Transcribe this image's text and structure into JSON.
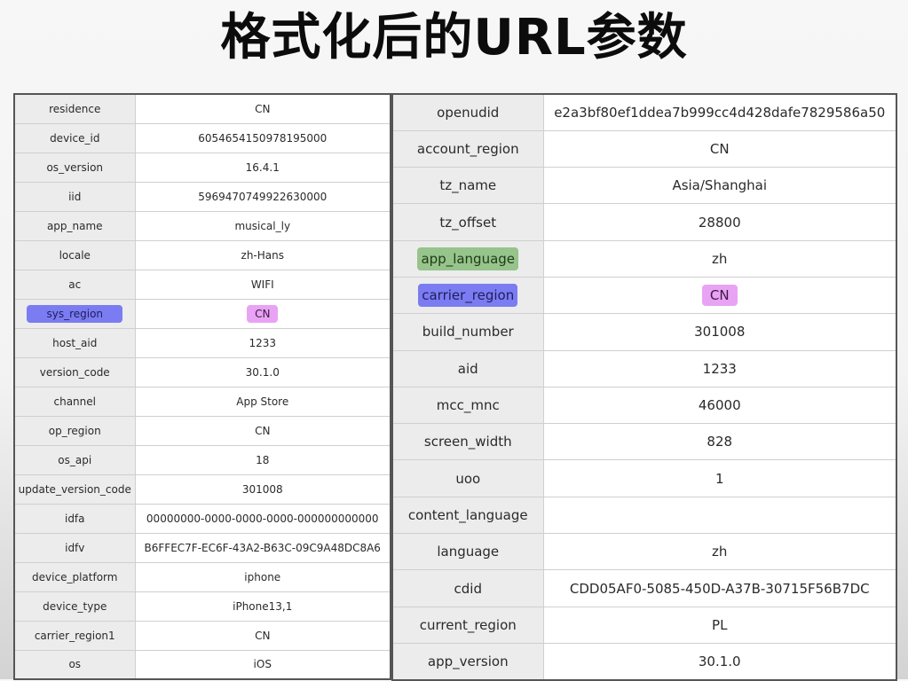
{
  "title": "格式化后的URL参数",
  "colors": {
    "highlight_blue": "#7b7cf2",
    "highlight_pink": "#e9a3f4",
    "highlight_green": "#96c48a"
  },
  "left_rows": [
    {
      "key": "residence",
      "value": "CN"
    },
    {
      "key": "device_id",
      "value": "6054654150978195000"
    },
    {
      "key": "os_version",
      "value": "16.4.1"
    },
    {
      "key": "iid",
      "value": "5969470749922630000"
    },
    {
      "key": "app_name",
      "value": "musical_ly"
    },
    {
      "key": "locale",
      "value": "zh-Hans"
    },
    {
      "key": "ac",
      "value": "WIFI"
    },
    {
      "key": "sys_region",
      "value": "CN",
      "key_highlight": "blue",
      "value_highlight": "pink"
    },
    {
      "key": "host_aid",
      "value": "1233"
    },
    {
      "key": "version_code",
      "value": "30.1.0"
    },
    {
      "key": "channel",
      "value": "App Store"
    },
    {
      "key": "op_region",
      "value": "CN"
    },
    {
      "key": "os_api",
      "value": "18"
    },
    {
      "key": "update_version_code",
      "value": "301008"
    },
    {
      "key": "idfa",
      "value": "00000000-0000-0000-0000-000000000000"
    },
    {
      "key": "idfv",
      "value": "B6FFEC7F-EC6F-43A2-B63C-09C9A48DC8A6"
    },
    {
      "key": "device_platform",
      "value": "iphone"
    },
    {
      "key": "device_type",
      "value": "iPhone13,1"
    },
    {
      "key": "carrier_region1",
      "value": "CN"
    },
    {
      "key": "os",
      "value": "iOS"
    }
  ],
  "right_rows": [
    {
      "key": "openudid",
      "value": "e2a3bf80ef1ddea7b999cc4d428dafe7829586a50"
    },
    {
      "key": "account_region",
      "value": "CN"
    },
    {
      "key": "tz_name",
      "value": "Asia/Shanghai"
    },
    {
      "key": "tz_offset",
      "value": "28800"
    },
    {
      "key": "app_language",
      "value": "zh",
      "key_highlight": "green"
    },
    {
      "key": "carrier_region",
      "value": "CN",
      "key_highlight": "blue",
      "value_highlight": "pink"
    },
    {
      "key": "build_number",
      "value": "301008"
    },
    {
      "key": "aid",
      "value": "1233"
    },
    {
      "key": "mcc_mnc",
      "value": "46000"
    },
    {
      "key": "screen_width",
      "value": "828"
    },
    {
      "key": "uoo",
      "value": "1"
    },
    {
      "key": "content_language",
      "value": ""
    },
    {
      "key": "language",
      "value": "zh"
    },
    {
      "key": "cdid",
      "value": "CDD05AF0-5085-450D-A37B-30715F56B7DC"
    },
    {
      "key": "current_region",
      "value": "PL"
    },
    {
      "key": "app_version",
      "value": "30.1.0"
    }
  ]
}
